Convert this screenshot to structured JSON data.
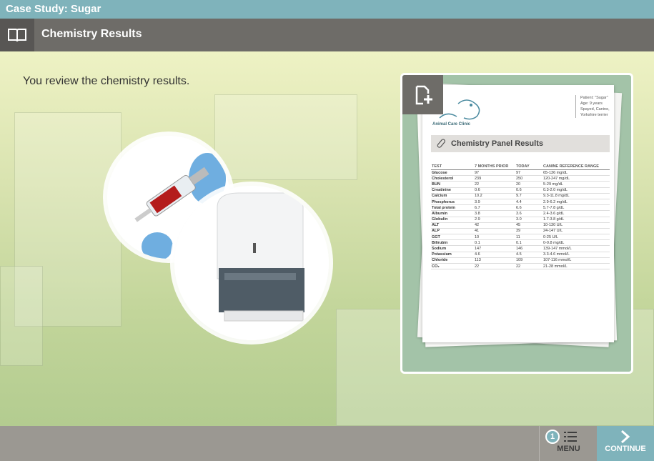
{
  "app": {
    "title": "Case Study: Sugar"
  },
  "section": {
    "title": "Chemistry Results",
    "icon": "book-icon"
  },
  "main": {
    "instruction": "You review the chemistry results."
  },
  "document": {
    "expand_icon": "add-document-icon",
    "clinic_name": "Animal Care Clinic",
    "patient": {
      "line1": "Patient: \"Sugar\"",
      "line2": "Age: 9 years",
      "line3": "Spayed, Canine,",
      "line4": "Yorkshire terrier"
    },
    "panel_title": "Chemistry Panel Results",
    "columns": [
      "TEST",
      "7 MONTHS PRIOR",
      "TODAY",
      "CANINE REFERENCE RANGE"
    ],
    "rows": [
      [
        "Glucose",
        "97",
        "97",
        "65-136 mg/dL"
      ],
      [
        "Cholesterol",
        "239",
        "250",
        "120-247 mg/dL"
      ],
      [
        "BUN",
        "22",
        "20",
        "5-29 mg/dL"
      ],
      [
        "Creatinine",
        "0.6",
        "0.6",
        "0.3-2.0 mg/dL"
      ],
      [
        "Calcium",
        "10.2",
        "9.7",
        "9.3-11.8 mg/dL"
      ],
      [
        "Phosphorus",
        "3.9",
        "4.4",
        "2.9-6.2 mg/dL"
      ],
      [
        "Total protein",
        "6.7",
        "6.6",
        "5.7-7.8 g/dL"
      ],
      [
        "Albumin",
        "3.8",
        "3.6",
        "2.4-3.6 g/dL"
      ],
      [
        "Globulin",
        "2.9",
        "3.0",
        "1.7-3.8 g/dL"
      ],
      [
        "ALT",
        "42",
        "45",
        "10-130 U/L"
      ],
      [
        "ALP",
        "41",
        "39",
        "24-147 U/L"
      ],
      [
        "GGT",
        "10",
        "11",
        "0-25 U/L"
      ],
      [
        "Bilirubin",
        "0.1",
        "0.1",
        "0-0.8 mg/dL"
      ],
      [
        "Sodium",
        "147",
        "146",
        "139-147 mmol/L"
      ],
      [
        "Potassium",
        "4.6",
        "4.5",
        "3.3-4.6 mmol/L"
      ],
      [
        "Chloride",
        "113",
        "109",
        "107-116 mmol/L"
      ],
      [
        "CO₂",
        "22",
        "22",
        "21-28 mmol/L"
      ]
    ]
  },
  "toolbar": {
    "menu_badge": "1",
    "menu_label": "MENU",
    "continue_label": "CONTINUE"
  },
  "colors": {
    "accent": "#7fb3bb",
    "header": "#6e6c68",
    "toolbar": "#9b9892"
  }
}
